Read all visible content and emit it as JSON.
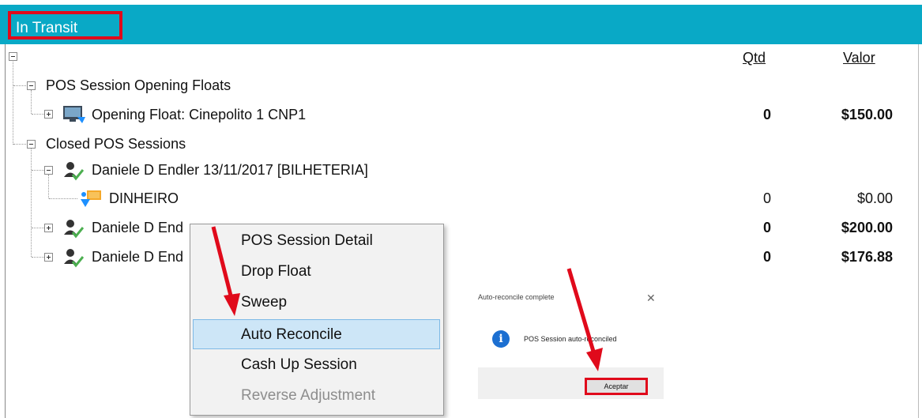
{
  "header": {
    "title": "In Transit"
  },
  "columns": {
    "qtd": "Qtd",
    "valor": "Valor"
  },
  "tree": {
    "opening_floats": {
      "label": "POS Session Opening Floats",
      "child": {
        "label": "Opening Float: Cinepolito 1 CNP1",
        "qtd": "0",
        "valor": "$150.00"
      }
    },
    "closed_sessions": {
      "label": "Closed POS Sessions",
      "sessions": [
        {
          "label": "Daniele D Endler 13/11/2017 [BILHETERIA]",
          "children": [
            {
              "label": "DINHEIRO",
              "qtd": "0",
              "valor": "$0.00"
            }
          ]
        },
        {
          "label": "Daniele D End",
          "qtd": "0",
          "valor": "$200.00"
        },
        {
          "label": "Daniele D End",
          "qtd": "0",
          "valor": "$176.88"
        }
      ]
    }
  },
  "context_menu": {
    "items": [
      {
        "label": "POS Session Detail"
      },
      {
        "label": "Drop Float"
      },
      {
        "label": "Sweep"
      },
      {
        "label": "Auto Reconcile",
        "highlighted": true
      },
      {
        "label": "Cash Up Session"
      },
      {
        "label": "Reverse Adjustment",
        "disabled": true
      }
    ]
  },
  "dialog": {
    "title": "Auto-reconcile complete",
    "message": "POS Session auto-reconciled",
    "accept_label": "Aceptar"
  },
  "colors": {
    "header_bg": "#09a9c6",
    "annotation_red": "#e00a1b",
    "menu_highlight": "#cde6f7"
  }
}
